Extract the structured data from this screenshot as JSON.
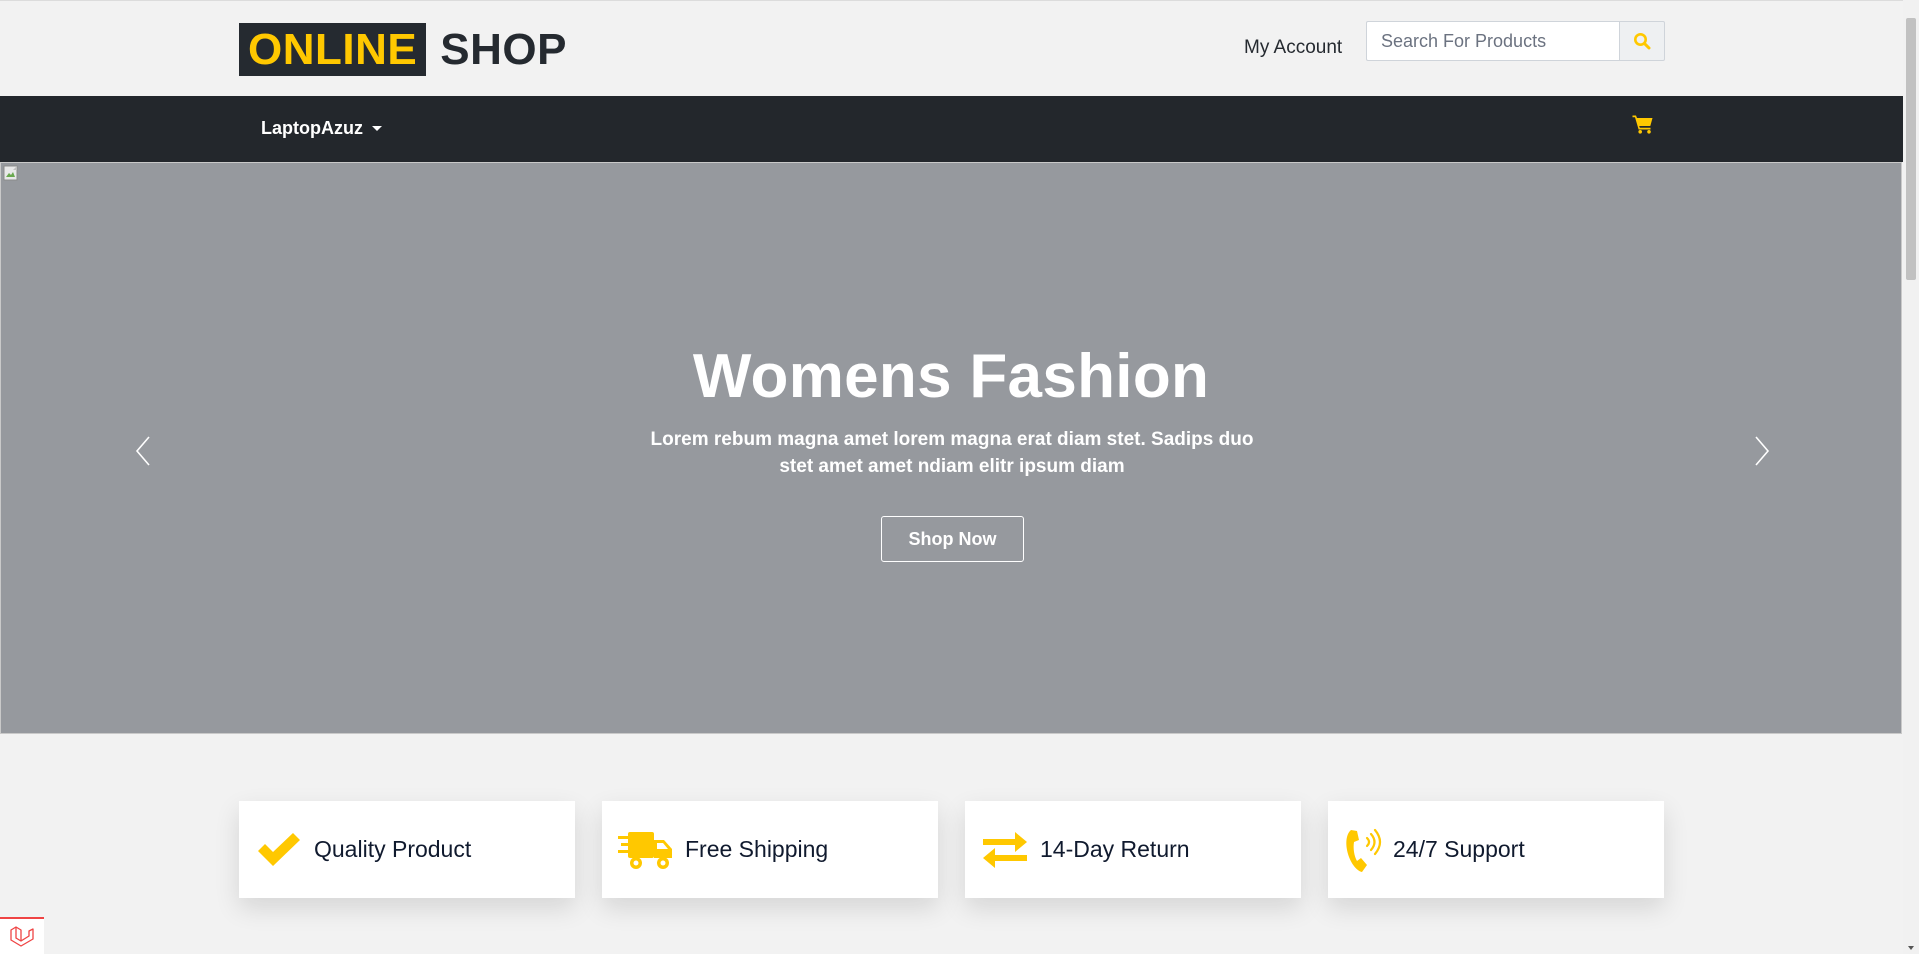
{
  "header": {
    "logo_highlight": "ONLINE",
    "logo_text": "SHOP",
    "my_account": "My Account",
    "search": {
      "placeholder": "Search For Products",
      "value": "",
      "icon": "search-icon"
    }
  },
  "nav": {
    "brand": "LaptopAzuz",
    "dropdown_icon": "caret-down-icon",
    "cart_icon": "cart-icon"
  },
  "hero": {
    "title": "Womens Fashion",
    "text": "Lorem rebum magna amet lorem magna erat diam stet. Sadips duo stet amet amet ndiam elitr ipsum diam",
    "button": "Shop Now",
    "prev_icon": "chevron-left-icon",
    "next_icon": "chevron-right-icon"
  },
  "features": [
    {
      "label": "Quality Product",
      "icon": "check-icon"
    },
    {
      "label": "Free Shipping",
      "icon": "shipping-truck-icon"
    },
    {
      "label": "14-Day Return",
      "icon": "exchange-arrows-icon"
    },
    {
      "label": "24/7 Support",
      "icon": "phone-volume-icon"
    }
  ],
  "colors": {
    "accent": "#ffc800",
    "dark": "#23272c",
    "hero_bg": "#96999e",
    "page_bg": "#f2f2f2"
  }
}
